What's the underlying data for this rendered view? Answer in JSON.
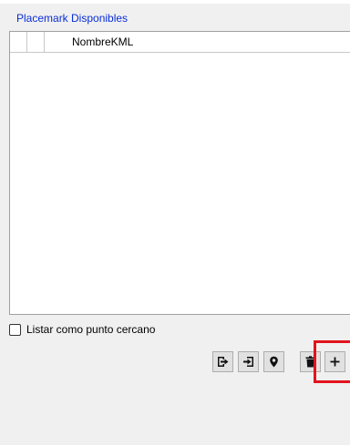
{
  "group": {
    "title": "Placemark Disponibles"
  },
  "grid": {
    "columns": [
      "",
      "",
      "NombreKML"
    ],
    "rows": []
  },
  "options": {
    "listar_label": "Listar como punto cercano",
    "listar_checked": false
  },
  "toolbar": {
    "buttons": [
      {
        "name": "export-icon"
      },
      {
        "name": "import-icon"
      },
      {
        "name": "map-pin-icon"
      },
      {
        "name": "trash-icon"
      },
      {
        "name": "plus-icon"
      }
    ]
  },
  "colors": {
    "title": "#0a2fd6",
    "highlight": "#e2131c",
    "background": "#f0f0f0"
  }
}
